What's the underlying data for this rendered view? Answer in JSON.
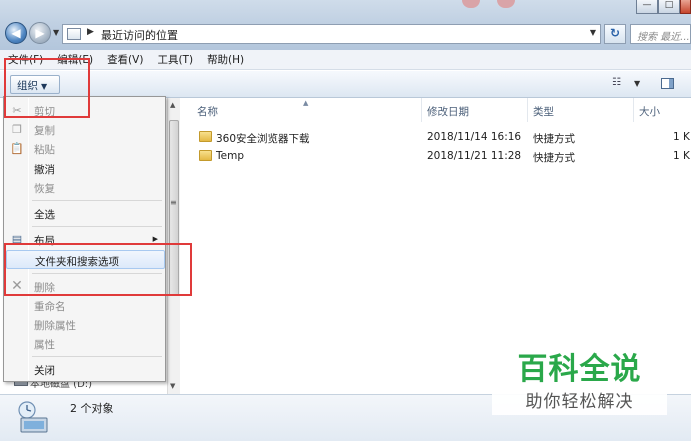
{
  "window": {
    "address_path": "最近访问的位置",
    "search_placeholder": "搜索 最近...",
    "min_glyph": "—",
    "max_glyph": "□",
    "back_glyph": "◀",
    "forward_glyph": "▶"
  },
  "menubar": {
    "items": [
      "文件(F)",
      "编辑(E)",
      "查看(V)",
      "工具(T)",
      "帮助(H)"
    ]
  },
  "toolbar": {
    "organize_label": "组织",
    "view_icon": "view-toggle-icon",
    "pane_icon": "preview-pane-icon"
  },
  "organize_menu": {
    "items": [
      {
        "label": "剪切",
        "enabled": false,
        "icon": "scissors-icon"
      },
      {
        "label": "复制",
        "enabled": false,
        "icon": "copy-icon"
      },
      {
        "label": "粘贴",
        "enabled": false,
        "icon": "paste-icon"
      },
      {
        "label": "撤消",
        "enabled": true
      },
      {
        "label": "恢复",
        "enabled": false
      },
      {
        "label": "全选",
        "enabled": true
      },
      {
        "label": "布局",
        "enabled": true,
        "submenu": true,
        "icon": "layout-icon"
      },
      {
        "label": "文件夹和搜索选项",
        "enabled": true,
        "highlighted": true
      },
      {
        "label": "删除",
        "enabled": false,
        "icon": "delete-x-icon"
      },
      {
        "label": "重命名",
        "enabled": false
      },
      {
        "label": "删除属性",
        "enabled": false
      },
      {
        "label": "属性",
        "enabled": false
      },
      {
        "label": "关闭",
        "enabled": true
      }
    ]
  },
  "nav_pane": {
    "partial_item": "本地磁盘 (D:)"
  },
  "file_list": {
    "columns": {
      "name": "名称",
      "modified": "修改日期",
      "type": "类型",
      "size": "大小"
    },
    "rows": [
      {
        "name": "360安全浏览器下载",
        "modified": "2018/11/14 16:16",
        "type": "快捷方式",
        "size": "1 K"
      },
      {
        "name": "Temp",
        "modified": "2018/11/21 11:28",
        "type": "快捷方式",
        "size": "1 K"
      }
    ]
  },
  "status": {
    "count_text": "2 个对象"
  },
  "watermark": {
    "title": "百科全说",
    "subtitle": "助你轻松解决"
  },
  "colors": {
    "annotation_red": "#e03a3a",
    "watermark_green": "#2aa84a"
  }
}
